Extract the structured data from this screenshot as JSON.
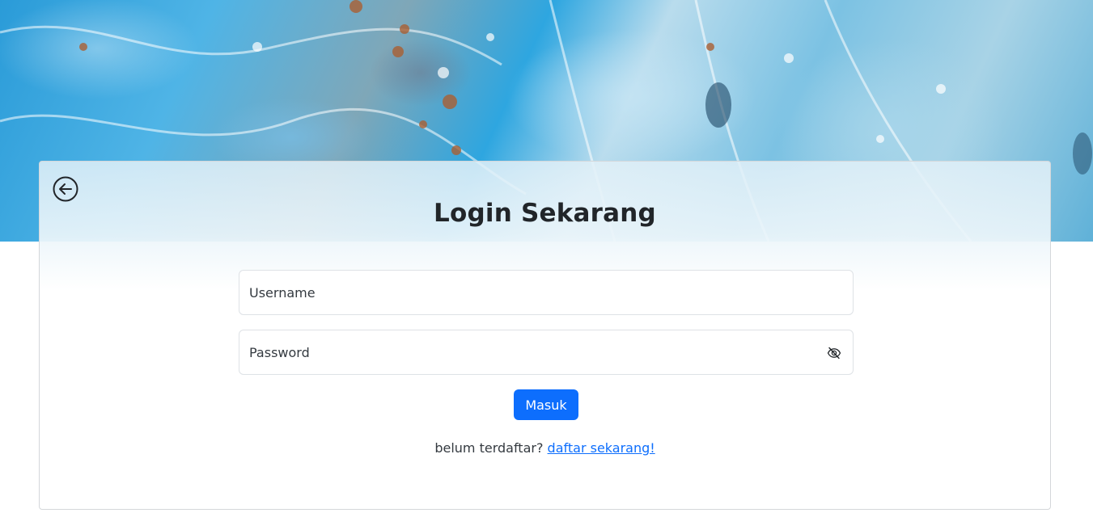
{
  "page": {
    "title": "Login Sekarang"
  },
  "form": {
    "username_placeholder": "Username",
    "username_value": "",
    "password_placeholder": "Password",
    "password_value": "",
    "submit_label": "Masuk"
  },
  "register": {
    "prompt": "belum terdaftar?",
    "link_label": "daftar sekarang!"
  },
  "icons": {
    "back": "arrow-left-circle-icon",
    "password_toggle": "eye-slash-icon"
  },
  "colors": {
    "primary": "#0d6efd",
    "text": "#212529",
    "border": "#dee2e6"
  }
}
